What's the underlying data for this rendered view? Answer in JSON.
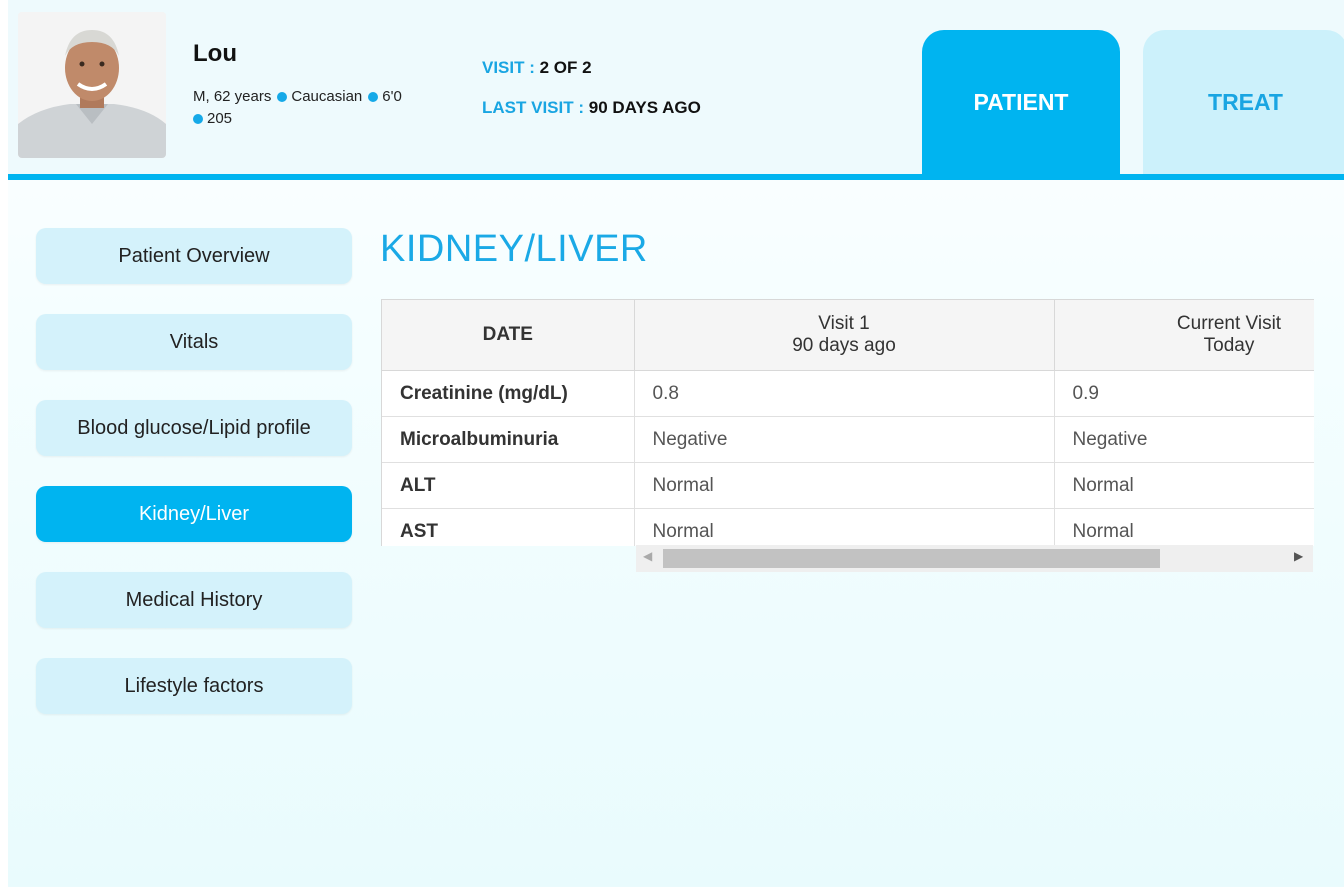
{
  "patient": {
    "name": "Lou",
    "sex_age": "M, 62 years",
    "ethnicity": "Caucasian",
    "height": "6'0",
    "weight": "205"
  },
  "visit": {
    "visit_label": "VISIT : ",
    "visit_value": "2 OF 2",
    "last_visit_label": "LAST VISIT : ",
    "last_visit_value": "90 DAYS AGO"
  },
  "tabs": [
    {
      "label": "PATIENT",
      "active": true
    },
    {
      "label": "TREAT",
      "active": false
    }
  ],
  "sidebar": {
    "items": [
      {
        "label": "Patient Overview",
        "active": false
      },
      {
        "label": "Vitals",
        "active": false
      },
      {
        "label": "Blood glucose/Lipid profile",
        "active": false
      },
      {
        "label": "Kidney/Liver",
        "active": true
      },
      {
        "label": "Medical History",
        "active": false
      },
      {
        "label": "Lifestyle factors",
        "active": false
      }
    ]
  },
  "main": {
    "title": "KIDNEY/LIVER",
    "table": {
      "headers": [
        {
          "line1": "DATE",
          "line2": ""
        },
        {
          "line1": "Visit 1",
          "line2": "90 days ago"
        },
        {
          "line1": "Current Visit",
          "line2": "Today"
        }
      ],
      "rows": [
        [
          "Creatinine (mg/dL)",
          "0.8",
          "0.9"
        ],
        [
          "Microalbuminuria",
          "Negative",
          "Negative"
        ],
        [
          "ALT",
          "Normal",
          "Normal"
        ],
        [
          "AST",
          "Normal",
          "Normal"
        ]
      ]
    }
  },
  "colors": {
    "accent": "#00b4f0",
    "accent_text": "#1aa9e6",
    "tab_inactive": "#ccf1fb",
    "nav_inactive": "#d4f2fb"
  }
}
